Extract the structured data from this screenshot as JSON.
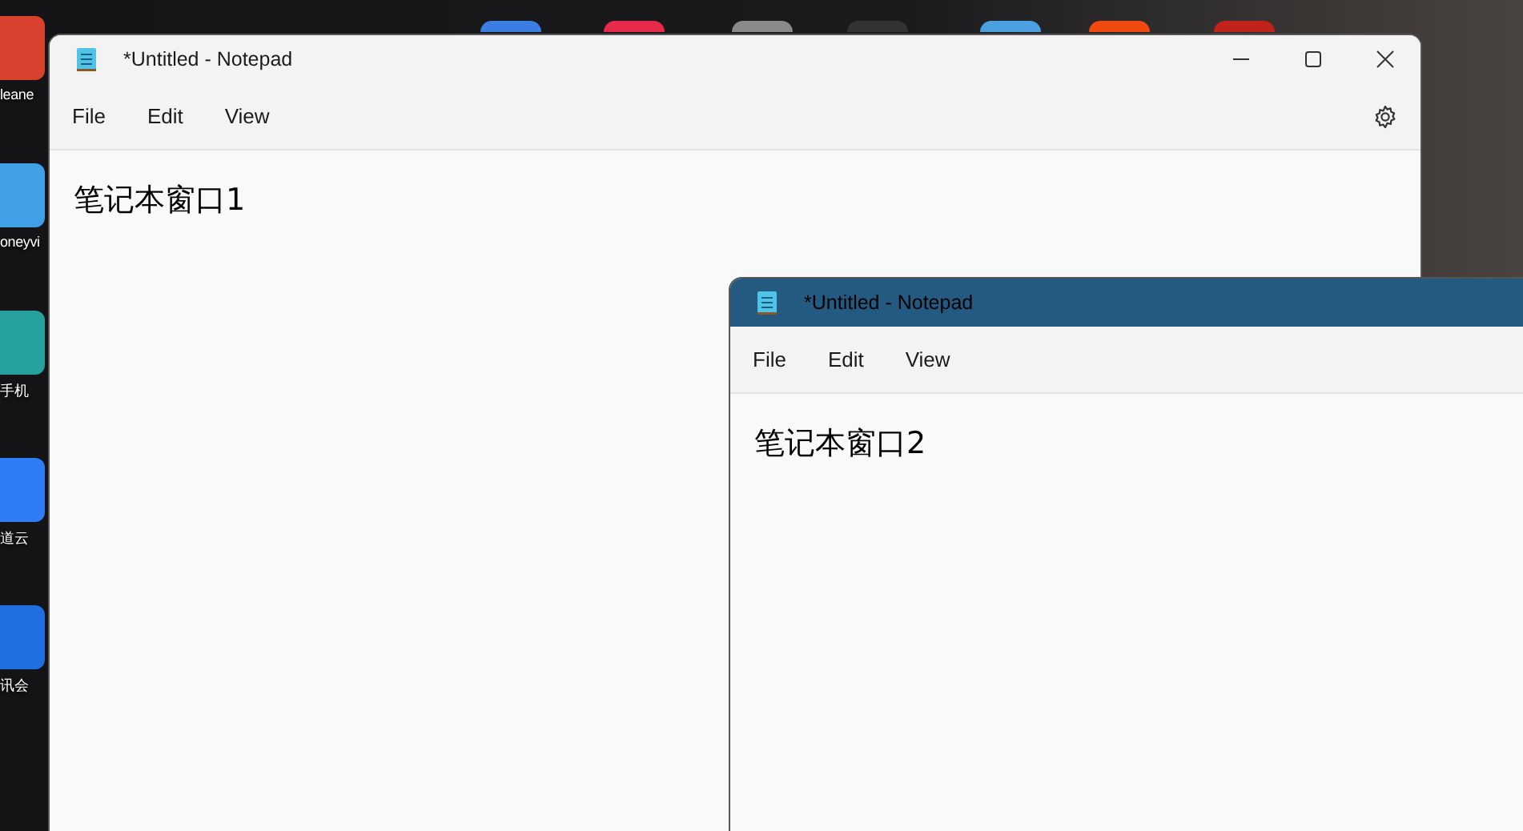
{
  "desktop_icons": [
    {
      "label": "leane"
    },
    {
      "label": "oneyvi"
    },
    {
      "label": "手机"
    },
    {
      "label": "道云"
    },
    {
      "label": "讯会"
    }
  ],
  "windows": [
    {
      "title": "*Untitled - Notepad",
      "active": false,
      "menu": [
        "File",
        "Edit",
        "View"
      ],
      "text": "笔记本窗口1",
      "controls": true
    },
    {
      "title": "*Untitled - Notepad",
      "active": true,
      "menu": [
        "File",
        "Edit",
        "View"
      ],
      "text": "笔记本窗口2",
      "controls": false
    }
  ]
}
